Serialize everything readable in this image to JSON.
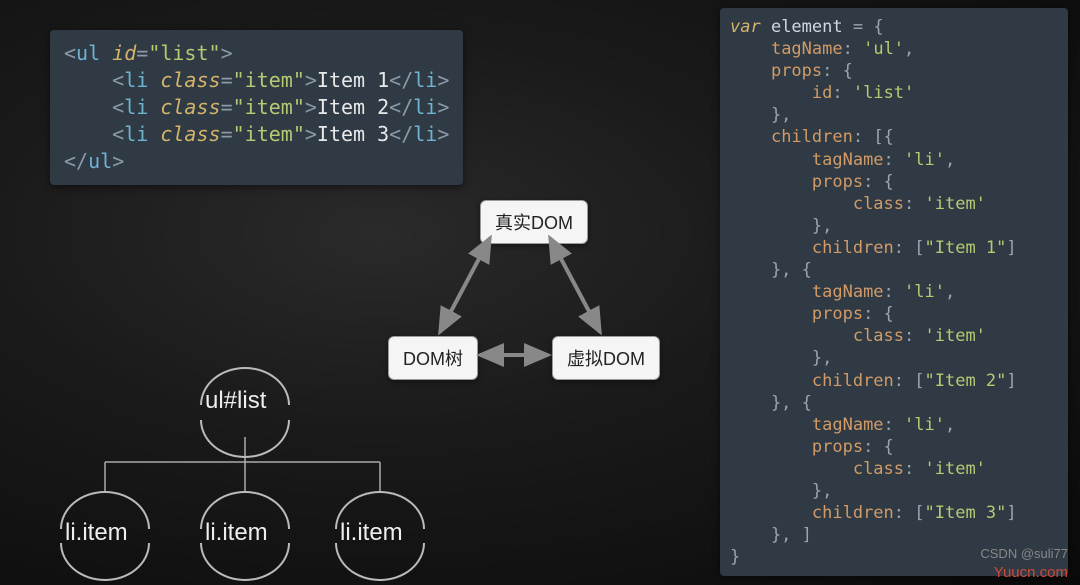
{
  "html_code": {
    "line1": {
      "open": "<ul ",
      "attr": "id",
      "eq": "=",
      "val": "\"list\"",
      "close": ">"
    },
    "items": [
      {
        "indent": "    ",
        "open": "<li ",
        "attr": "class",
        "eq": "=",
        "val": "\"item\"",
        "mid": ">",
        "text": "Item 1",
        "closeTag": "</li>"
      },
      {
        "indent": "    ",
        "open": "<li ",
        "attr": "class",
        "eq": "=",
        "val": "\"item\"",
        "mid": ">",
        "text": "Item 2",
        "closeTag": "</li>"
      },
      {
        "indent": "    ",
        "open": "<li ",
        "attr": "class",
        "eq": "=",
        "val": "\"item\"",
        "mid": ">",
        "text": "Item 3",
        "closeTag": "</li>"
      }
    ],
    "close": "</ul>"
  },
  "js_code_lines": [
    [
      [
        "kw",
        "var "
      ],
      [
        "var",
        "element"
      ],
      [
        "punc",
        " = {"
      ]
    ],
    [
      [
        "punc",
        "    "
      ],
      [
        "key",
        "tagName"
      ],
      [
        "punc",
        ": "
      ],
      [
        "val",
        "'ul'"
      ],
      [
        "punc",
        ","
      ]
    ],
    [
      [
        "punc",
        "    "
      ],
      [
        "key",
        "props"
      ],
      [
        "punc",
        ": {"
      ]
    ],
    [
      [
        "punc",
        "        "
      ],
      [
        "key",
        "id"
      ],
      [
        "punc",
        ": "
      ],
      [
        "val",
        "'list'"
      ]
    ],
    [
      [
        "punc",
        "    },"
      ]
    ],
    [
      [
        "punc",
        "    "
      ],
      [
        "key",
        "children"
      ],
      [
        "punc",
        ": [{"
      ]
    ],
    [
      [
        "punc",
        "        "
      ],
      [
        "key",
        "tagName"
      ],
      [
        "punc",
        ": "
      ],
      [
        "val",
        "'li'"
      ],
      [
        "punc",
        ","
      ]
    ],
    [
      [
        "punc",
        "        "
      ],
      [
        "key",
        "props"
      ],
      [
        "punc",
        ": {"
      ]
    ],
    [
      [
        "punc",
        "            "
      ],
      [
        "key",
        "class"
      ],
      [
        "punc",
        ": "
      ],
      [
        "val",
        "'item'"
      ]
    ],
    [
      [
        "punc",
        "        },"
      ]
    ],
    [
      [
        "punc",
        "        "
      ],
      [
        "key",
        "children"
      ],
      [
        "punc",
        ": ["
      ],
      [
        "val",
        "\"Item 1\""
      ],
      [
        "punc",
        "]"
      ]
    ],
    [
      [
        "punc",
        "    }, {"
      ]
    ],
    [
      [
        "punc",
        "        "
      ],
      [
        "key",
        "tagName"
      ],
      [
        "punc",
        ": "
      ],
      [
        "val",
        "'li'"
      ],
      [
        "punc",
        ","
      ]
    ],
    [
      [
        "punc",
        "        "
      ],
      [
        "key",
        "props"
      ],
      [
        "punc",
        ": {"
      ]
    ],
    [
      [
        "punc",
        "            "
      ],
      [
        "key",
        "class"
      ],
      [
        "punc",
        ": "
      ],
      [
        "val",
        "'item'"
      ]
    ],
    [
      [
        "punc",
        "        },"
      ]
    ],
    [
      [
        "punc",
        "        "
      ],
      [
        "key",
        "children"
      ],
      [
        "punc",
        ": ["
      ],
      [
        "val",
        "\"Item 2\""
      ],
      [
        "punc",
        "]"
      ]
    ],
    [
      [
        "punc",
        "    }, {"
      ]
    ],
    [
      [
        "punc",
        "        "
      ],
      [
        "key",
        "tagName"
      ],
      [
        "punc",
        ": "
      ],
      [
        "val",
        "'li'"
      ],
      [
        "punc",
        ","
      ]
    ],
    [
      [
        "punc",
        "        "
      ],
      [
        "key",
        "props"
      ],
      [
        "punc",
        ": {"
      ]
    ],
    [
      [
        "punc",
        "            "
      ],
      [
        "key",
        "class"
      ],
      [
        "punc",
        ": "
      ],
      [
        "val",
        "'item'"
      ]
    ],
    [
      [
        "punc",
        "        },"
      ]
    ],
    [
      [
        "punc",
        "        "
      ],
      [
        "key",
        "children"
      ],
      [
        "punc",
        ": ["
      ],
      [
        "val",
        "\"Item 3\""
      ],
      [
        "punc",
        "]"
      ]
    ],
    [
      [
        "punc",
        "    }, ]"
      ]
    ],
    [
      [
        "punc",
        "}"
      ]
    ]
  ],
  "nodes": {
    "real": "真实DOM",
    "tree": "DOM树",
    "virtual": "虚拟DOM"
  },
  "tree": {
    "root": "ul#list",
    "children": [
      "li.item",
      "li.item",
      "li.item"
    ]
  },
  "watermarks": {
    "csdn": "CSDN @suli77",
    "yuucn": "Yuucn.com"
  }
}
